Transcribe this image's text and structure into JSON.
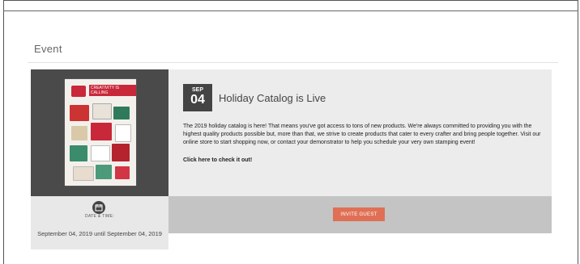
{
  "section": {
    "title": "Event"
  },
  "event": {
    "month": "SEP",
    "day": "04",
    "title": "Holiday Catalog is Live",
    "description": "The 2019 holiday catalog is here! That means you've got access to tons of new products. We're always committed to providing you with the highest quality products possible but, more than that, we strive to create products that cater to every crafter and bring people together. Visit our online store to start shopping now, or contact your demonstrator to help you schedule your very own stamping event!",
    "link_text": "Click here to check it out!",
    "cover_brand": "CREATIVITY IS CALLING",
    "datetime_label": "DATE & TIME:",
    "datetime_value": "September 04, 2019 until September 04, 2019",
    "invite_label": "INVITE GUEST"
  },
  "colors": {
    "accent": "#e07055",
    "badge": "#444444"
  }
}
